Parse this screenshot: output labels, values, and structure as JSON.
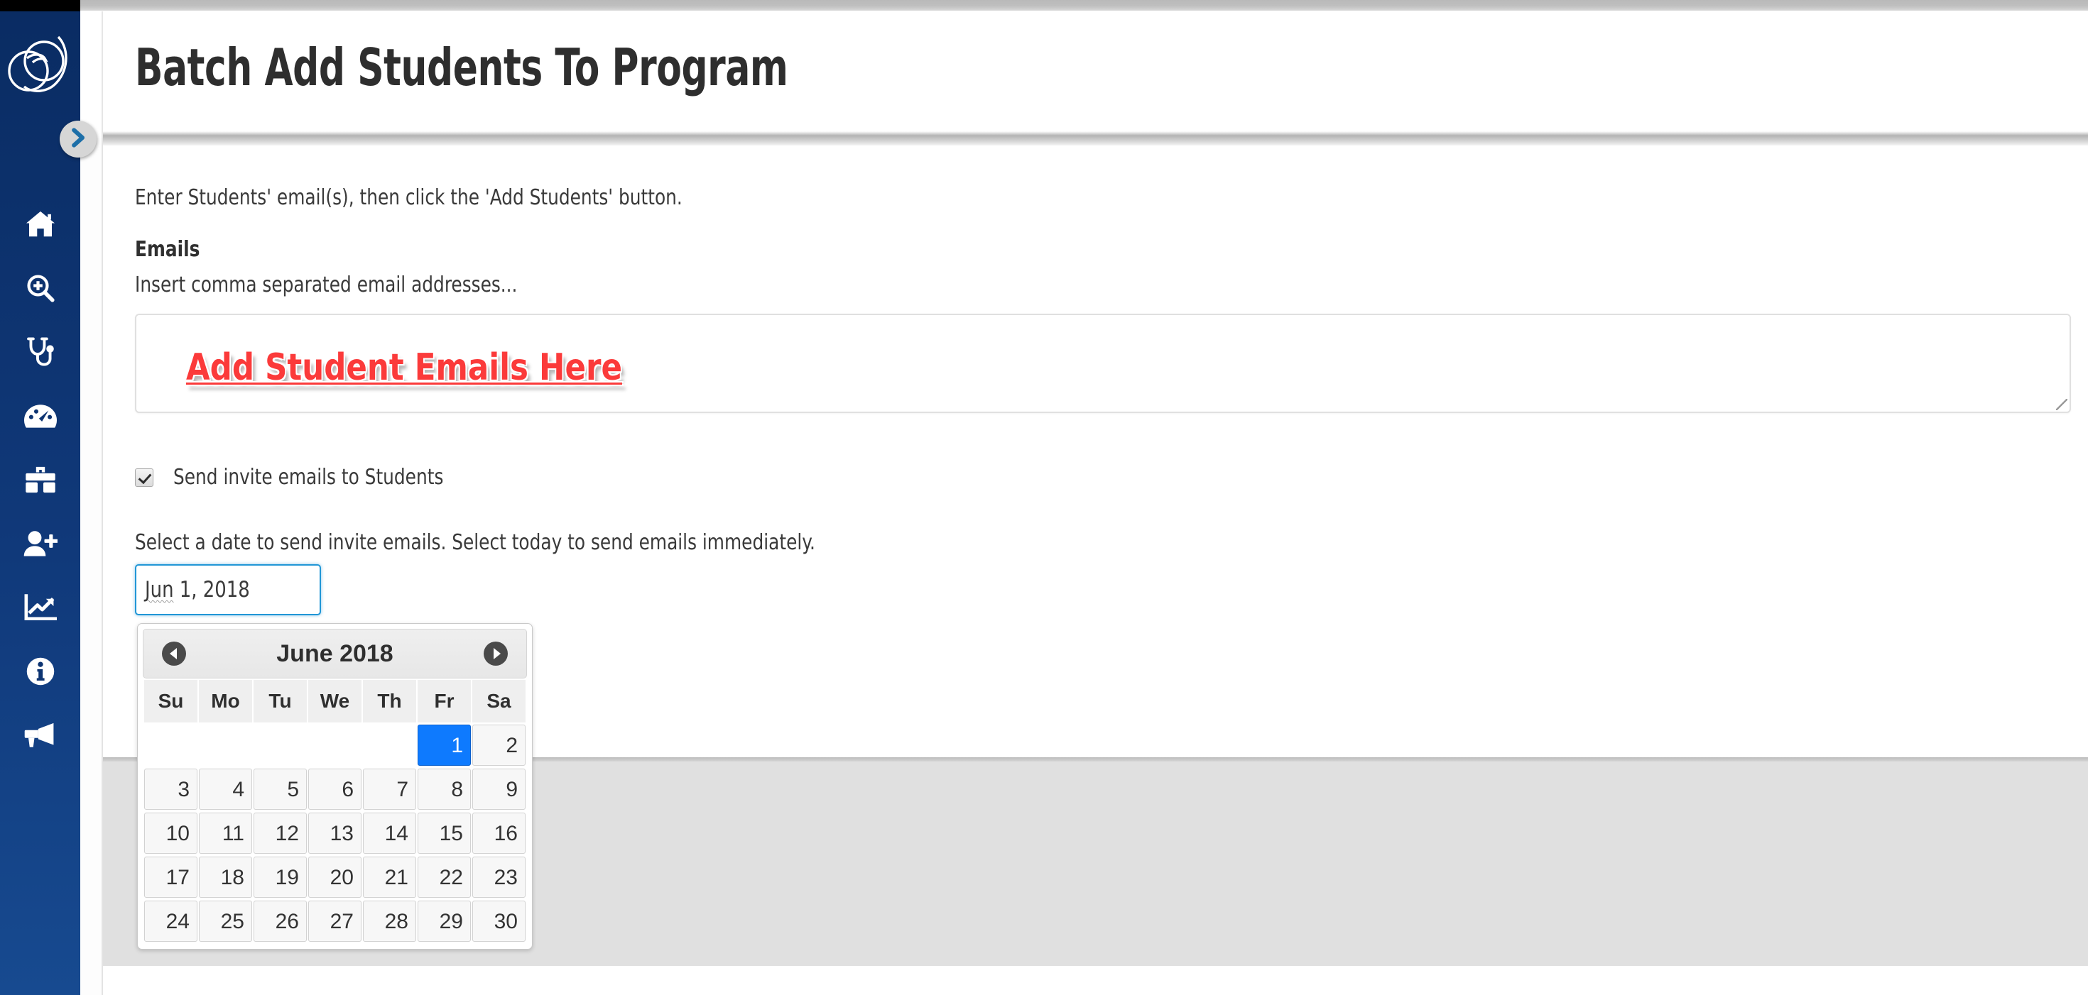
{
  "colors": {
    "sidebar_bg": "#0d3472",
    "accent_blue": "#0e7afe",
    "annotation_red": "#fb3a3a",
    "focus_blue": "#2196d6",
    "title_gray": "#2e2e2e",
    "footer_gray": "#e0e0e0"
  },
  "sidebar": {
    "logo_name": "brand-logo",
    "toggle_label": "expand-sidebar",
    "items": [
      {
        "icon": "home-icon",
        "label": "Home"
      },
      {
        "icon": "search-plus-icon",
        "label": "Search"
      },
      {
        "icon": "stethoscope-icon",
        "label": "Clinical"
      },
      {
        "icon": "dashboard-gauge-icon",
        "label": "Dashboard"
      },
      {
        "icon": "toolbox-icon",
        "label": "Toolbox"
      },
      {
        "icon": "user-plus-icon",
        "label": "Add User"
      },
      {
        "icon": "chart-line-icon",
        "label": "Reports"
      },
      {
        "icon": "info-circle-icon",
        "label": "Information"
      },
      {
        "icon": "bullhorn-icon",
        "label": "Announcements"
      }
    ]
  },
  "header": {
    "title": "Batch Add Students To Program"
  },
  "form": {
    "intro_text": "Enter Students' email(s), then click the 'Add Students' button.",
    "emails_label": "Emails",
    "emails_hint": "Insert comma separated email addresses...",
    "emails_value": "",
    "emails_placeholder": "",
    "annotation_text": "Add Student Emails Here",
    "invite_checkbox_label": "Send invite emails to Students",
    "invite_checkbox_checked": true,
    "date_instruction": "Select a date to send invite emails. Select today to send emails immediately.",
    "date_value_prefix": "Jun",
    "date_value_rest": " 1, 2018",
    "date_value": "Jun 1, 2018"
  },
  "datepicker": {
    "month_title": "June 2018",
    "prev_label": "Previous month",
    "next_label": "Next month",
    "weekday_headers": [
      "Su",
      "Mo",
      "Tu",
      "We",
      "Th",
      "Fr",
      "Sa"
    ],
    "selected_day": 1,
    "weeks": [
      [
        "",
        "",
        "",
        "",
        "",
        "1",
        "2"
      ],
      [
        "3",
        "4",
        "5",
        "6",
        "7",
        "8",
        "9"
      ],
      [
        "10",
        "11",
        "12",
        "13",
        "14",
        "15",
        "16"
      ],
      [
        "17",
        "18",
        "19",
        "20",
        "21",
        "22",
        "23"
      ],
      [
        "24",
        "25",
        "26",
        "27",
        "28",
        "29",
        "30"
      ]
    ]
  }
}
